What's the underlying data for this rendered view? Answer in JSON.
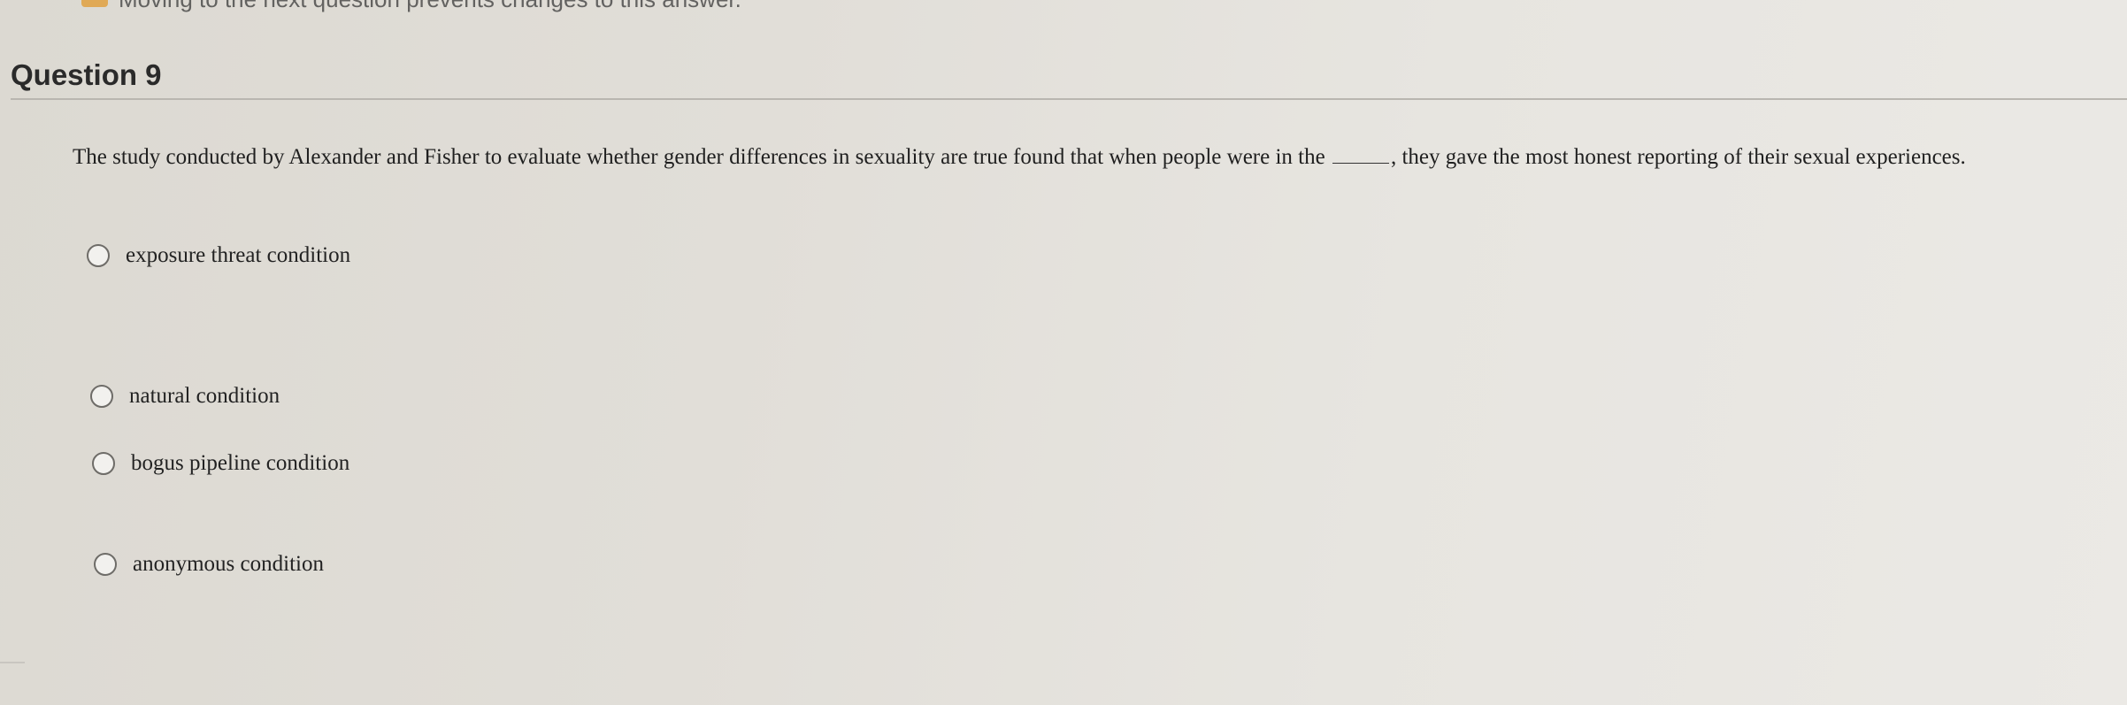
{
  "top_notice": "Moving to the next question prevents changes to this answer.",
  "question": {
    "title": "Question 9",
    "text_before_blank": "The study conducted by Alexander and Fisher to evaluate whether gender differences in sexuality are true found that when people were in the",
    "text_after_blank": ", they gave the most honest reporting of their sexual experiences."
  },
  "options": [
    {
      "label": "exposure threat condition",
      "selected": false
    },
    {
      "label": "natural condition",
      "selected": false
    },
    {
      "label": "bogus pipeline condition",
      "selected": false
    },
    {
      "label": "anonymous condition",
      "selected": false
    }
  ]
}
